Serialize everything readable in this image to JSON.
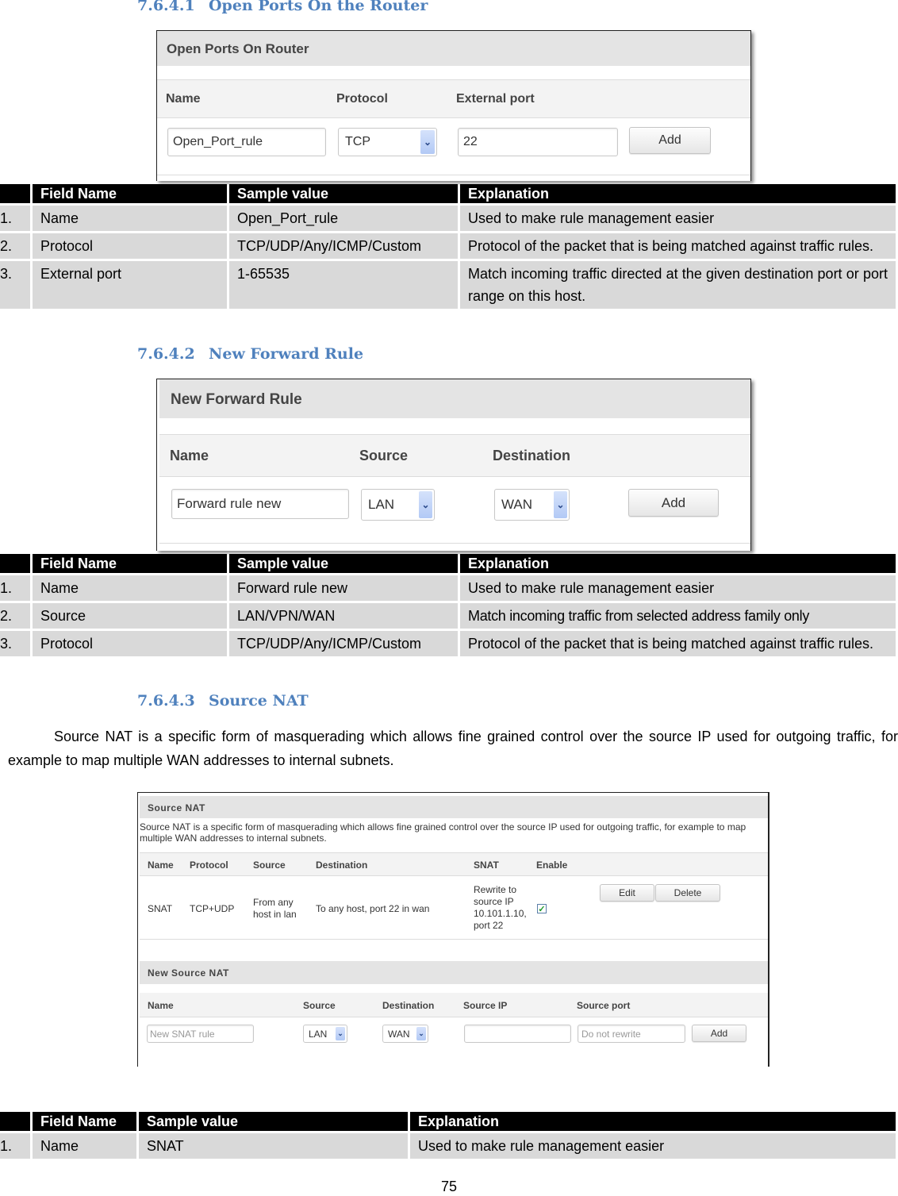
{
  "sections": [
    {
      "number": "7.6.4.1",
      "title": "Open Ports On the Router",
      "screenshot": {
        "title": "Open Ports On Router",
        "columns": [
          "Name",
          "Protocol",
          "External port"
        ],
        "name_value": "Open_Port_rule",
        "protocol_value": "TCP",
        "external_port_value": "22",
        "add_label": "Add"
      },
      "table": {
        "headers": [
          "",
          "Field Name",
          "Sample value",
          "Explanation"
        ],
        "rows": [
          [
            "1.",
            "Name",
            "Open_Port_rule",
            "Used to make rule management easier"
          ],
          [
            "2.",
            "Protocol",
            "TCP/UDP/Any/ICMP/Custom",
            "Protocol of the packet that is being matched against traffic rules."
          ],
          [
            "3.",
            "External port",
            "1-65535",
            "Match incoming traffic directed at the given destination port or port range on this host."
          ]
        ]
      }
    },
    {
      "number": "7.6.4.2",
      "title": "New Forward Rule",
      "screenshot": {
        "title": "New Forward Rule",
        "columns": [
          "Name",
          "Source",
          "Destination"
        ],
        "name_value": "Forward rule new",
        "source_value": "LAN",
        "destination_value": "WAN",
        "add_label": "Add"
      },
      "table": {
        "headers": [
          "",
          "Field Name",
          "Sample value",
          "Explanation"
        ],
        "rows": [
          [
            "1.",
            "Name",
            "Forward rule new",
            "Used to make rule management easier"
          ],
          [
            "2.",
            "Source",
            "LAN/VPN/WAN",
            "Match incoming traffic from selected address family only"
          ],
          [
            "3.",
            "Protocol",
            "TCP/UDP/Any/ICMP/Custom",
            "Protocol of the packet that is being matched against traffic rules."
          ]
        ]
      }
    },
    {
      "number": "7.6.4.3",
      "title": "Source NAT",
      "intro": "Source NAT is a specific form of masquerading which allows fine grained control over the source IP used for outgoing traffic, for example to map multiple WAN addresses to internal subnets.",
      "screenshot": {
        "title": "Source NAT",
        "description": "Source NAT is a specific form of masquerading which allows fine grained control over the source IP used for outgoing traffic, for example to map multiple WAN addresses to internal subnets.",
        "columns": [
          "Name",
          "Protocol",
          "Source",
          "Destination",
          "SNAT",
          "Enable"
        ],
        "row": {
          "name": "SNAT",
          "protocol": "TCP+UDP",
          "source": "From any host in lan",
          "destination": "To any host, port 22 in wan",
          "snat": "Rewrite to source IP 10.101.1.10, port 22",
          "enabled": true,
          "edit_label": "Edit",
          "delete_label": "Delete"
        },
        "new_title": "New Source NAT",
        "new_columns": [
          "Name",
          "Source",
          "Destination",
          "Source IP",
          "Source port"
        ],
        "new_name_placeholder": "New SNAT rule",
        "new_source_value": "LAN",
        "new_destination_value": "WAN",
        "new_source_ip_value": "",
        "new_source_port_placeholder": "Do not rewrite",
        "add_label": "Add"
      },
      "table": {
        "headers": [
          "",
          "Field Name",
          "Sample value",
          "Explanation"
        ],
        "rows": [
          [
            "1.",
            "Name",
            "SNAT",
            "Used to make rule management easier"
          ]
        ]
      }
    }
  ],
  "page_number": "75"
}
